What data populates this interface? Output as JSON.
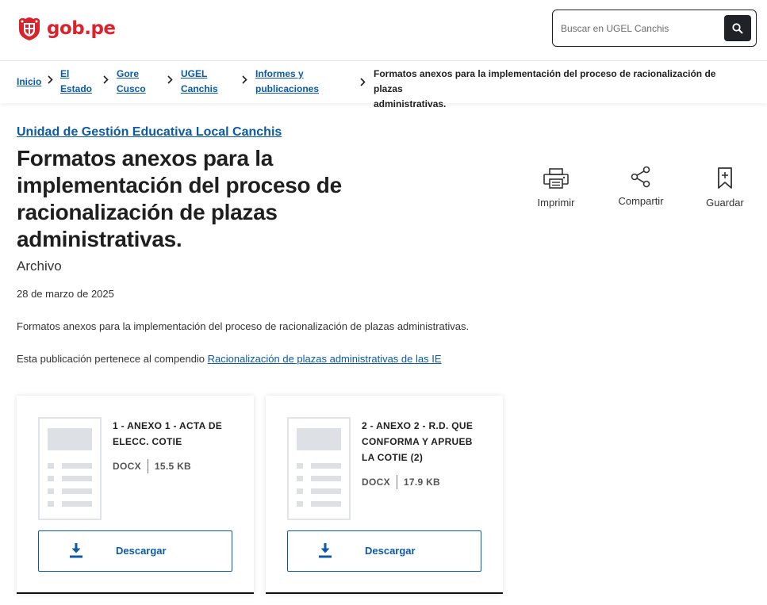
{
  "header": {
    "logo_text": "gob.pe",
    "search_placeholder": "Buscar en UGEL Canchis"
  },
  "breadcrumb": {
    "items": [
      {
        "line1": "Inicio",
        "line2": ""
      },
      {
        "line1": "El",
        "line2": "Estado"
      },
      {
        "line1": "Gore",
        "line2": "Cusco"
      },
      {
        "line1": "UGEL",
        "line2": "Canchis"
      },
      {
        "line1": "Informes y",
        "line2": "publicaciones"
      }
    ],
    "current_line1": "Formatos anexos para la implementación del proceso de racionalización de plazas",
    "current_line2": "administrativas."
  },
  "page": {
    "organization": "Unidad de Gestión Educativa Local Canchis",
    "title_lines": [
      "Formatos anexos para la",
      "implementación del proceso de",
      "racionalización de plazas",
      "administrativas."
    ],
    "type": "Archivo",
    "date": "28 de marzo de 2025",
    "description": "Formatos anexos para la implementación del proceso de racionalización de plazas administrativas.",
    "compendium_prefix": "Esta publicación pertenece al compendio",
    "compendium_link": "Racionalización de plazas administrativas de las IE"
  },
  "actions": {
    "print": "Imprimir",
    "share": "Compartir",
    "save": "Guardar"
  },
  "files": [
    {
      "title_lines": [
        "1 - ANEXO 1 - ACTA DE",
        "ELECC. COTIE"
      ],
      "format": "DOCX",
      "size": "15.5 KB",
      "download": "Descargar"
    },
    {
      "title_lines": [
        "2 - ANEXO 2 - R.D. QUE",
        "CONFORMA Y APRUEB",
        "LA COTIE (2)"
      ],
      "format": "DOCX",
      "size": "17.9 KB",
      "download": "Descargar"
    }
  ],
  "colors": {
    "brand_red": "#d9232d",
    "link_blue": "#0b5aa8",
    "text_dark": "#1f1f1f"
  },
  "icons": [
    "peru-shield-icon",
    "search-icon",
    "chevron-right-icon",
    "printer-icon",
    "share-icon",
    "bookmark-icon",
    "document-thumbnail-icon",
    "download-icon"
  ]
}
